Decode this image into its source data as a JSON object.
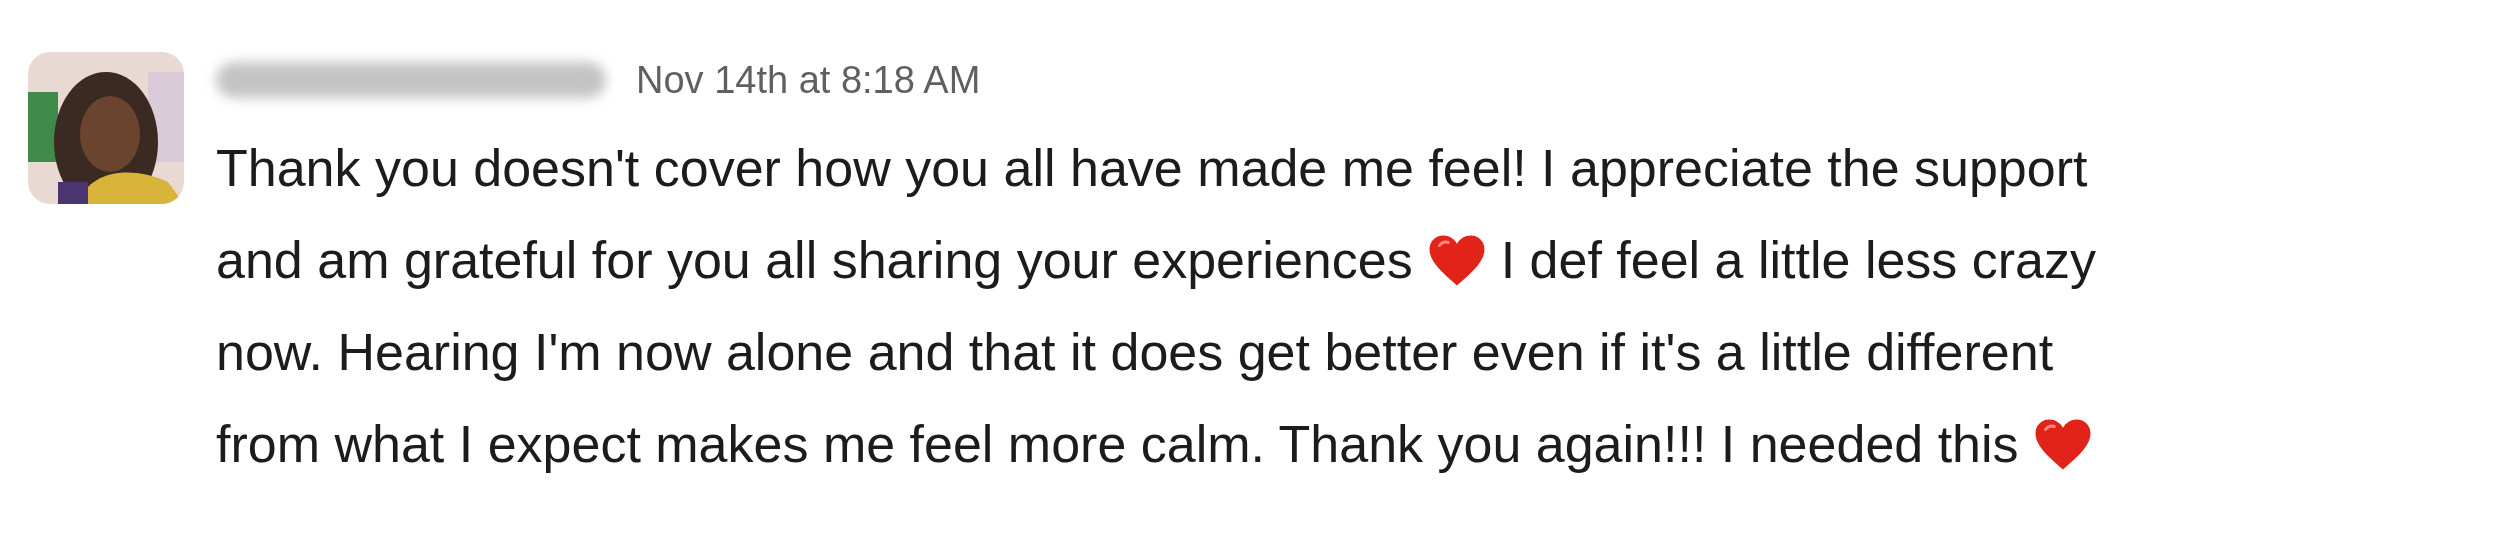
{
  "message": {
    "avatar": {
      "kind": "picture"
    },
    "timestamp": "Nov 14th at 8:18 AM",
    "lines": [
      [
        {
          "kind": "text",
          "text": "Thank you doesn't cover how you all have made me feel! I appreciate the support"
        }
      ],
      [
        {
          "kind": "text",
          "text": "and am grateful for you all sharing your experiences"
        },
        {
          "kind": "heart"
        },
        {
          "kind": "text",
          "text": "I def feel a little less crazy"
        }
      ],
      [
        {
          "kind": "text",
          "text": "now. Hearing I'm now alone and that it does get better even if it's a little different"
        }
      ],
      [
        {
          "kind": "text",
          "text": "from what I expect makes me feel more calm. Thank you again!!! I needed this"
        },
        {
          "kind": "heart"
        }
      ]
    ]
  }
}
